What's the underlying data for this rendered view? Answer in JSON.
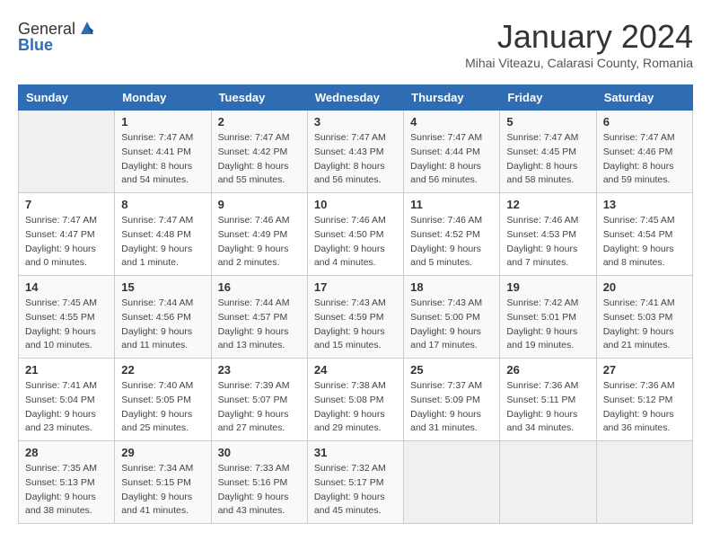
{
  "logo": {
    "general": "General",
    "blue": "Blue"
  },
  "title": "January 2024",
  "location": "Mihai Viteazu, Calarasi County, Romania",
  "days_header": [
    "Sunday",
    "Monday",
    "Tuesday",
    "Wednesday",
    "Thursday",
    "Friday",
    "Saturday"
  ],
  "weeks": [
    [
      {
        "day": "",
        "info": ""
      },
      {
        "day": "1",
        "info": "Sunrise: 7:47 AM\nSunset: 4:41 PM\nDaylight: 8 hours\nand 54 minutes."
      },
      {
        "day": "2",
        "info": "Sunrise: 7:47 AM\nSunset: 4:42 PM\nDaylight: 8 hours\nand 55 minutes."
      },
      {
        "day": "3",
        "info": "Sunrise: 7:47 AM\nSunset: 4:43 PM\nDaylight: 8 hours\nand 56 minutes."
      },
      {
        "day": "4",
        "info": "Sunrise: 7:47 AM\nSunset: 4:44 PM\nDaylight: 8 hours\nand 56 minutes."
      },
      {
        "day": "5",
        "info": "Sunrise: 7:47 AM\nSunset: 4:45 PM\nDaylight: 8 hours\nand 58 minutes."
      },
      {
        "day": "6",
        "info": "Sunrise: 7:47 AM\nSunset: 4:46 PM\nDaylight: 8 hours\nand 59 minutes."
      }
    ],
    [
      {
        "day": "7",
        "info": "Sunrise: 7:47 AM\nSunset: 4:47 PM\nDaylight: 9 hours\nand 0 minutes."
      },
      {
        "day": "8",
        "info": "Sunrise: 7:47 AM\nSunset: 4:48 PM\nDaylight: 9 hours\nand 1 minute."
      },
      {
        "day": "9",
        "info": "Sunrise: 7:46 AM\nSunset: 4:49 PM\nDaylight: 9 hours\nand 2 minutes."
      },
      {
        "day": "10",
        "info": "Sunrise: 7:46 AM\nSunset: 4:50 PM\nDaylight: 9 hours\nand 4 minutes."
      },
      {
        "day": "11",
        "info": "Sunrise: 7:46 AM\nSunset: 4:52 PM\nDaylight: 9 hours\nand 5 minutes."
      },
      {
        "day": "12",
        "info": "Sunrise: 7:46 AM\nSunset: 4:53 PM\nDaylight: 9 hours\nand 7 minutes."
      },
      {
        "day": "13",
        "info": "Sunrise: 7:45 AM\nSunset: 4:54 PM\nDaylight: 9 hours\nand 8 minutes."
      }
    ],
    [
      {
        "day": "14",
        "info": "Sunrise: 7:45 AM\nSunset: 4:55 PM\nDaylight: 9 hours\nand 10 minutes."
      },
      {
        "day": "15",
        "info": "Sunrise: 7:44 AM\nSunset: 4:56 PM\nDaylight: 9 hours\nand 11 minutes."
      },
      {
        "day": "16",
        "info": "Sunrise: 7:44 AM\nSunset: 4:57 PM\nDaylight: 9 hours\nand 13 minutes."
      },
      {
        "day": "17",
        "info": "Sunrise: 7:43 AM\nSunset: 4:59 PM\nDaylight: 9 hours\nand 15 minutes."
      },
      {
        "day": "18",
        "info": "Sunrise: 7:43 AM\nSunset: 5:00 PM\nDaylight: 9 hours\nand 17 minutes."
      },
      {
        "day": "19",
        "info": "Sunrise: 7:42 AM\nSunset: 5:01 PM\nDaylight: 9 hours\nand 19 minutes."
      },
      {
        "day": "20",
        "info": "Sunrise: 7:41 AM\nSunset: 5:03 PM\nDaylight: 9 hours\nand 21 minutes."
      }
    ],
    [
      {
        "day": "21",
        "info": "Sunrise: 7:41 AM\nSunset: 5:04 PM\nDaylight: 9 hours\nand 23 minutes."
      },
      {
        "day": "22",
        "info": "Sunrise: 7:40 AM\nSunset: 5:05 PM\nDaylight: 9 hours\nand 25 minutes."
      },
      {
        "day": "23",
        "info": "Sunrise: 7:39 AM\nSunset: 5:07 PM\nDaylight: 9 hours\nand 27 minutes."
      },
      {
        "day": "24",
        "info": "Sunrise: 7:38 AM\nSunset: 5:08 PM\nDaylight: 9 hours\nand 29 minutes."
      },
      {
        "day": "25",
        "info": "Sunrise: 7:37 AM\nSunset: 5:09 PM\nDaylight: 9 hours\nand 31 minutes."
      },
      {
        "day": "26",
        "info": "Sunrise: 7:36 AM\nSunset: 5:11 PM\nDaylight: 9 hours\nand 34 minutes."
      },
      {
        "day": "27",
        "info": "Sunrise: 7:36 AM\nSunset: 5:12 PM\nDaylight: 9 hours\nand 36 minutes."
      }
    ],
    [
      {
        "day": "28",
        "info": "Sunrise: 7:35 AM\nSunset: 5:13 PM\nDaylight: 9 hours\nand 38 minutes."
      },
      {
        "day": "29",
        "info": "Sunrise: 7:34 AM\nSunset: 5:15 PM\nDaylight: 9 hours\nand 41 minutes."
      },
      {
        "day": "30",
        "info": "Sunrise: 7:33 AM\nSunset: 5:16 PM\nDaylight: 9 hours\nand 43 minutes."
      },
      {
        "day": "31",
        "info": "Sunrise: 7:32 AM\nSunset: 5:17 PM\nDaylight: 9 hours\nand 45 minutes."
      },
      {
        "day": "",
        "info": ""
      },
      {
        "day": "",
        "info": ""
      },
      {
        "day": "",
        "info": ""
      }
    ]
  ]
}
